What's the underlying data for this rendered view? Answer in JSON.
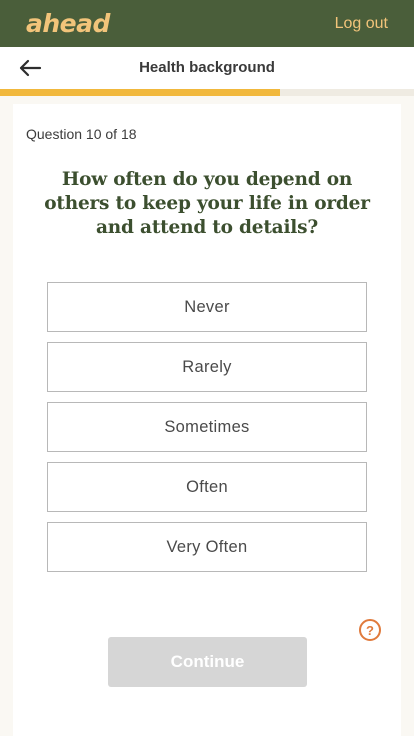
{
  "app": {
    "logo": "ahead",
    "logout_label": "Log out"
  },
  "header": {
    "title": "Health background",
    "back_icon": "arrow-left-icon"
  },
  "progress": {
    "current": 10,
    "total": 18,
    "fraction": 0.676
  },
  "question": {
    "counter": "Question 10 of 18",
    "text": "How often do you depend on others to keep your life in order and attend to details?"
  },
  "options": [
    {
      "label": "Never"
    },
    {
      "label": "Rarely"
    },
    {
      "label": "Sometimes"
    },
    {
      "label": "Often"
    },
    {
      "label": "Very Often"
    }
  ],
  "help": {
    "icon": "question-circle-icon",
    "glyph": "?"
  },
  "continue_label": "Continue",
  "colors": {
    "topbar": "#4a5e3a",
    "brand_accent": "#f2c47a",
    "progress": "#f1b83c",
    "question_text": "#3c4f2f",
    "help_icon": "#e07a3c",
    "disabled_button": "#d6d6d6"
  }
}
